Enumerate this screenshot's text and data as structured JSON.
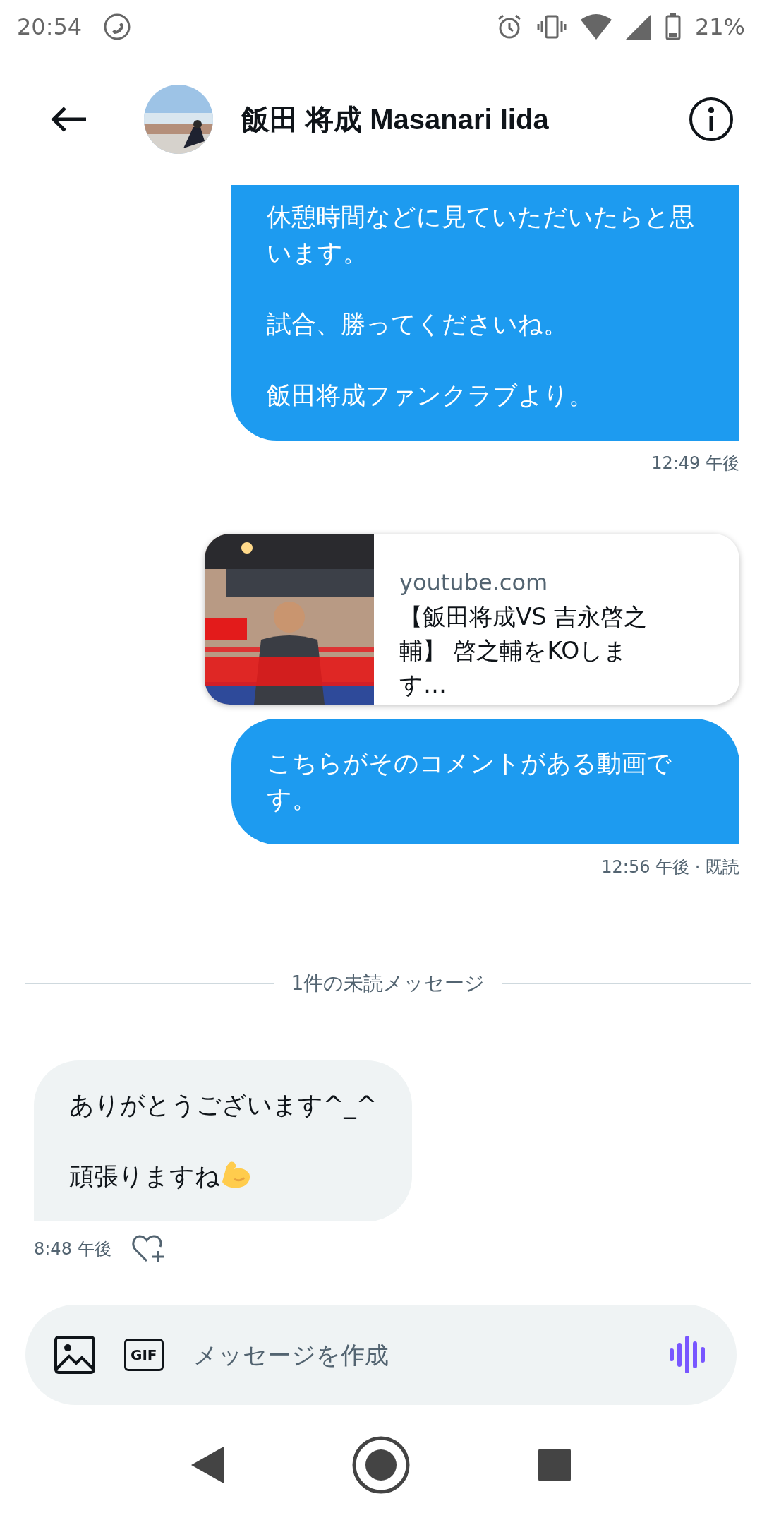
{
  "status_bar": {
    "time": "20:54",
    "battery": "21%"
  },
  "header": {
    "title": "飯田 将成 Masanari Iida"
  },
  "messages": [
    {
      "kind": "sent",
      "cut_top": true,
      "paragraphs": [
        "休憩時間などに見ていただいたらと思います。",
        "試合、勝ってくださいね。",
        "飯田将成ファンクラブより。"
      ],
      "time": "12:49 午後"
    },
    {
      "kind": "link",
      "domain": "youtube.com",
      "title": "【飯田将成VS 吉永啓之輔】 啓之輔をKOします…"
    },
    {
      "kind": "sent",
      "cut_top": false,
      "paragraphs": [
        "こちらがそのコメントがある動画です。"
      ],
      "time": "12:56 午後 · 既読"
    },
    {
      "kind": "divider",
      "label": "1件の未読メッセージ"
    },
    {
      "kind": "received",
      "cut_top": false,
      "paragraphs": [
        "ありがとうございます^_^",
        "頑張りますね"
      ],
      "emoji_end": true,
      "time": "8:48 午後",
      "like_button": true
    }
  ],
  "composer": {
    "gif_label": "GIF",
    "placeholder": "メッセージを作成"
  }
}
